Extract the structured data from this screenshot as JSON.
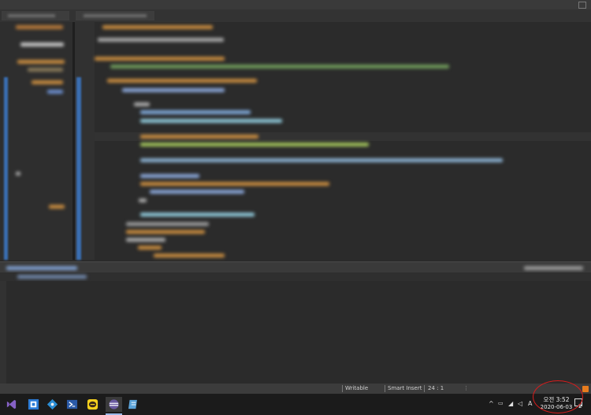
{
  "statusbar": {
    "writable": "Writable",
    "insert_mode": "Smart Insert",
    "position": "24 : 1"
  },
  "taskbar": {
    "apps": [
      {
        "icon": "visual-studio-icon",
        "color": "#8661c5"
      },
      {
        "icon": "app-window-icon",
        "color": "#2b7bd6"
      },
      {
        "icon": "git-icon",
        "color": "#2a8dd4"
      },
      {
        "icon": "powershell-icon",
        "color": "#2a5aa7"
      },
      {
        "icon": "kakaotalk-icon",
        "color": "#f7d21d"
      },
      {
        "icon": "eclipse-icon",
        "color": "#6a5aa0"
      },
      {
        "icon": "notepad-icon",
        "color": "#5ba3d9"
      }
    ],
    "tray": {
      "ime_label": "A",
      "notification_count": "2"
    },
    "clock": {
      "time": "오전 3:52",
      "date": "2020-06-03"
    }
  },
  "colors": {
    "annotation_circle": "#d91c1c",
    "taskbar": "#1b1b1b"
  }
}
